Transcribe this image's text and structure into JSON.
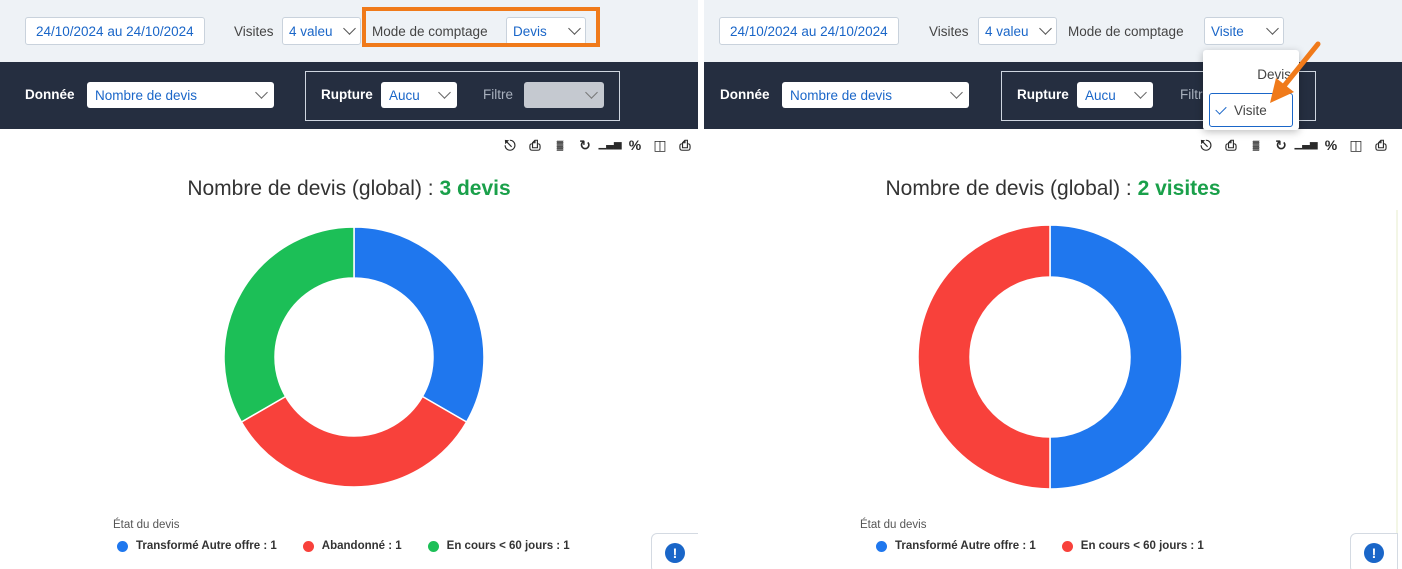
{
  "left": {
    "date_range": "24/10/2024 au 24/10/2024",
    "visites_label": "Visites",
    "visites_value": "4 valeu",
    "mode_label": "Mode de comptage",
    "mode_value": "Devis",
    "donnee_label": "Donnée",
    "donnee_value": "Nombre de devis",
    "rupture_label": "Rupture",
    "rupture_value": "Aucu",
    "filtre_label": "Filtre",
    "title_text": "Nombre de devis (global) : ",
    "title_count": "3 devis",
    "legend_title": "État du devis",
    "chart_data": {
      "type": "pie",
      "donut": true,
      "title": "Nombre de devis (global) : 3 devis",
      "categories": [
        "Transformé Autre offre",
        "Abandonné",
        "En cours < 60 jours"
      ],
      "values": [
        1,
        1,
        1
      ],
      "colors": [
        "#1f77ee",
        "#f8413b",
        "#1cbf57"
      ],
      "legend_labels": [
        "Transformé Autre offre : 1",
        "Abandonné : 1",
        "En cours < 60 jours : 1"
      ],
      "legend_position": "bottom"
    }
  },
  "right": {
    "date_range": "24/10/2024 au 24/10/2024",
    "visites_label": "Visites",
    "visites_value": "4 valeu",
    "mode_label": "Mode de comptage",
    "mode_value": "Visite",
    "donnee_label": "Donnée",
    "donnee_value": "Nombre de devis",
    "rupture_label": "Rupture",
    "rupture_value": "Aucu",
    "filtre_label": "Filtr",
    "dropdown_options": [
      "Devis",
      "Visite"
    ],
    "dropdown_selected": "Visite",
    "title_text": "Nombre de devis (global) : ",
    "title_count": "2 visites",
    "legend_title": "État du devis",
    "chart_data": {
      "type": "pie",
      "donut": true,
      "title": "Nombre de devis (global) : 2 visites",
      "categories": [
        "Transformé Autre offre",
        "En cours < 60 jours"
      ],
      "values": [
        1,
        1
      ],
      "colors": [
        "#1f77ee",
        "#f8413b"
      ],
      "legend_labels": [
        "Transformé Autre offre : 1",
        "En cours < 60 jours : 1"
      ],
      "legend_position": "bottom"
    }
  },
  "help_icon_glyph": "!",
  "accent_color": "#1a66c8",
  "highlight_color": "#f07a1a"
}
